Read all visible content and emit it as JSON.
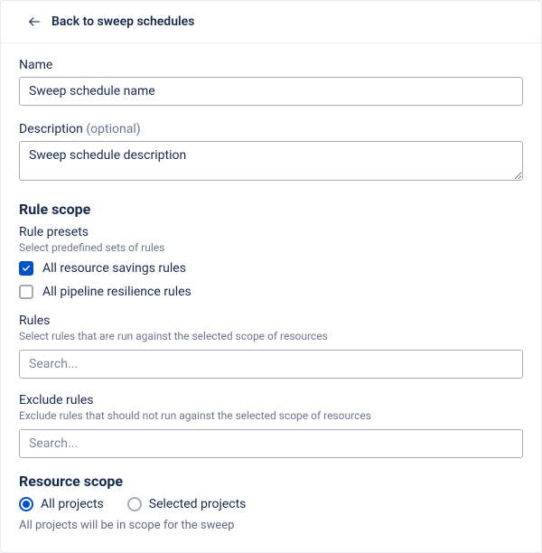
{
  "header": {
    "back_label": "Back to sweep schedules"
  },
  "name": {
    "label": "Name",
    "value": "Sweep schedule name"
  },
  "description": {
    "label": "Description",
    "optional": "(optional)",
    "value": "Sweep schedule description"
  },
  "ruleScope": {
    "heading": "Rule scope",
    "presets": {
      "label": "Rule presets",
      "helper": "Select predefined sets of rules",
      "options": [
        {
          "label": "All resource savings rules",
          "checked": true
        },
        {
          "label": "All pipeline resilience rules",
          "checked": false
        }
      ]
    },
    "rules": {
      "label": "Rules",
      "helper": "Select rules that are run against the selected scope of resources",
      "placeholder": "Search..."
    },
    "excludeRules": {
      "label": "Exclude rules",
      "helper": "Exclude rules that should not run against the selected scope of resources",
      "placeholder": "Search..."
    }
  },
  "resourceScope": {
    "heading": "Resource scope",
    "options": [
      {
        "label": "All projects",
        "selected": true
      },
      {
        "label": "Selected projects",
        "selected": false
      }
    ],
    "note": "All projects will be in scope for the sweep"
  }
}
